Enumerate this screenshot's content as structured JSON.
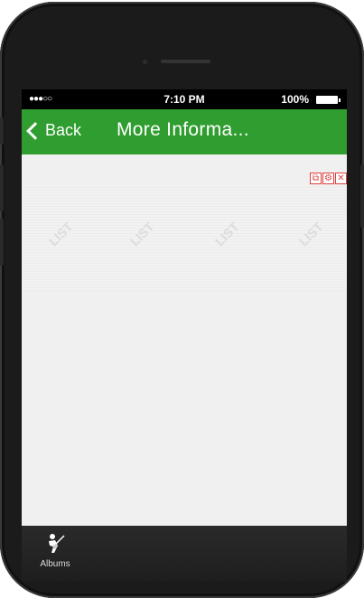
{
  "status_bar": {
    "signal": "●●●○○",
    "time": "7:10 PM",
    "battery_percent": "100%"
  },
  "nav_bar": {
    "back_label": "Back",
    "title": "More Informa...",
    "color": "#2f9d2f"
  },
  "toolbar": {
    "buttons": [
      {
        "icon": "copy-icon",
        "glyph": "⧉"
      },
      {
        "icon": "gear-icon",
        "glyph": "⚙"
      },
      {
        "icon": "close-icon",
        "glyph": "✕"
      }
    ]
  },
  "watermark": {
    "text": "LIST"
  },
  "tab_bar": {
    "items": [
      {
        "label": "Albums",
        "icon": "guitar-player-icon"
      }
    ]
  }
}
